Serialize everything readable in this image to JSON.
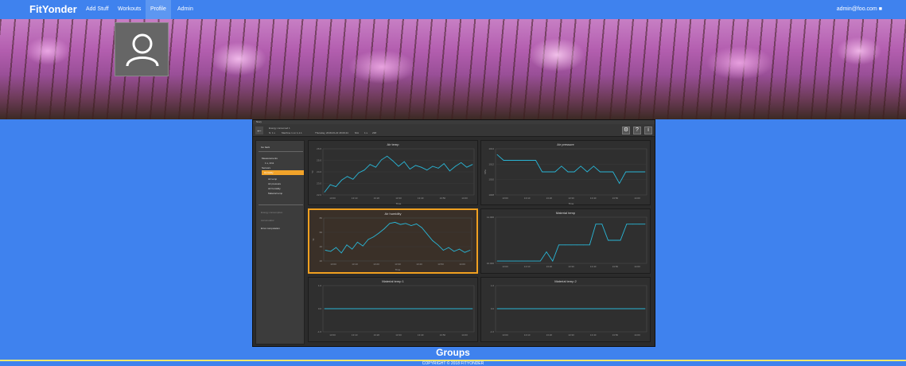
{
  "nav": {
    "brand": "FitYonder",
    "items": [
      "Add Stuff",
      "Workouts",
      "Profile",
      "Admin"
    ],
    "active": "Profile",
    "user": "admin@foo.com"
  },
  "colors": {
    "primary": "#3f82ee",
    "highlight": "#f0a020",
    "footer_line": "#f3e96b",
    "series": "#29b6d6"
  },
  "avatar_icon": "user-icon",
  "embedded_app": {
    "title": "Nuvy",
    "header": [
      "Energy consumed 1",
      "N: 1 s",
      "Machine 1 on 1-1.1",
      "Thursday, 2018-03-22 18:09:44",
      "N/A",
      "1 s",
      "238"
    ],
    "sidebar": {
      "back": "Go back",
      "items": [
        "Measurements",
        "1 s, 4/11",
        "Sensors",
        "Humidity",
        "Air temp",
        "Air pressure",
        "Air humidity",
        "Material temp",
        "Energy consumption",
        "Accumulator",
        "Error computation"
      ],
      "selected": "Humidity"
    },
    "charts": [
      {
        "title": "Air temp",
        "type": "line",
        "ylabel": "°C",
        "xlabel": "Time",
        "x_ticks": [
          "13:00",
          "13:10",
          "13:20",
          "13:30",
          "13:40",
          "13:50",
          "14:00"
        ],
        "y_ticks": [
          "26.0",
          "25.0",
          "24.0",
          "23.0",
          "22.0"
        ]
      },
      {
        "title": "Air pressure",
        "type": "line",
        "ylabel": "hPa",
        "xlabel": "Time",
        "x_ticks": [
          "13:00",
          "13:10",
          "13:20",
          "13:30",
          "13:40",
          "13:50",
          "14:00"
        ],
        "y_ticks": [
          "1014",
          "1012",
          "1010",
          "1008"
        ]
      },
      {
        "title": "Air humidity",
        "type": "line",
        "ylabel": "%",
        "xlabel": "Time",
        "highlighted": true,
        "x_ticks": [
          "13:00",
          "13:10",
          "13:20",
          "13:30",
          "13:40",
          "13:50",
          "14:00"
        ],
        "y_ticks": [
          "80",
          "60",
          "40",
          "20"
        ]
      },
      {
        "title": "Material temp",
        "type": "line",
        "ylabel": "",
        "xlabel": "",
        "x_ticks": [
          "13:00",
          "13:10",
          "13:20",
          "13:30",
          "13:40",
          "13:50",
          "14:00"
        ],
        "y_ticks": [
          "11.000",
          "10.000"
        ]
      },
      {
        "title": "Material temp 1",
        "type": "line",
        "ylabel": "",
        "xlabel": "",
        "x_ticks": [
          "13:00",
          "13:10",
          "13:20",
          "13:30",
          "13:40",
          "13:50",
          "14:00"
        ],
        "y_ticks": [
          "1.0",
          "0.0",
          "-1.0"
        ]
      },
      {
        "title": "Material temp 2",
        "type": "line",
        "ylabel": "",
        "xlabel": "",
        "x_ticks": [
          "13:00",
          "13:10",
          "13:20",
          "13:30",
          "13:40",
          "13:50",
          "14:00"
        ],
        "y_ticks": [
          "1.0",
          "0.0",
          "-1.0"
        ]
      }
    ]
  },
  "chart_data": [
    {
      "type": "line",
      "title": "Air temp",
      "xlabel": "Time",
      "ylabel": "°C",
      "ylim": [
        21.5,
        26.5
      ],
      "series": [
        {
          "values": [
            21.8,
            22.6,
            22.4,
            23.1,
            23.5,
            23.2,
            23.9,
            24.2,
            24.8,
            24.5,
            25.3,
            25.7,
            25.2,
            24.6,
            25.1,
            24.3,
            24.7,
            24.5,
            24.2,
            24.6,
            24.4,
            24.9,
            24.1,
            24.6,
            25.0,
            24.5,
            24.8
          ]
        }
      ]
    },
    {
      "type": "line",
      "title": "Air pressure",
      "xlabel": "Time",
      "ylabel": "hPa",
      "ylim": [
        1007,
        1015
      ],
      "series": [
        {
          "values": [
            1014,
            1013,
            1013,
            1013,
            1013,
            1013,
            1013,
            1011,
            1011,
            1011,
            1012,
            1011,
            1011,
            1012,
            1011,
            1012,
            1011,
            1011,
            1011,
            1009,
            1011,
            1011,
            1011,
            1011
          ]
        }
      ]
    },
    {
      "type": "line",
      "title": "Air humidity",
      "xlabel": "Time",
      "ylabel": "%",
      "ylim": [
        10,
        90
      ],
      "series": [
        {
          "values": [
            30,
            28,
            35,
            25,
            40,
            32,
            45,
            38,
            50,
            55,
            62,
            70,
            80,
            82,
            78,
            80,
            76,
            79,
            72,
            60,
            48,
            40,
            30,
            35,
            28,
            32,
            26,
            30
          ]
        }
      ]
    },
    {
      "type": "line",
      "title": "Material temp",
      "ylim": [
        9.5,
        11.5
      ],
      "series": [
        {
          "values": [
            9.6,
            9.6,
            9.6,
            9.6,
            9.6,
            9.6,
            9.6,
            9.6,
            10.0,
            9.6,
            10.3,
            10.3,
            10.3,
            10.3,
            10.3,
            10.3,
            11.2,
            11.2,
            10.5,
            10.5,
            10.5,
            11.2,
            11.2,
            11.2,
            11.2
          ]
        }
      ]
    },
    {
      "type": "line",
      "title": "Material temp 1",
      "ylim": [
        -1.2,
        1.2
      ],
      "series": [
        {
          "values": [
            0,
            0,
            0,
            0,
            0,
            0,
            0,
            0
          ]
        }
      ]
    },
    {
      "type": "line",
      "title": "Material temp 2",
      "ylim": [
        -1.2,
        1.2
      ],
      "series": [
        {
          "values": [
            0,
            0,
            0,
            0,
            0,
            0,
            0,
            0
          ]
        }
      ]
    }
  ],
  "groups_heading": "Groups",
  "footer": "COPYRIGHT © 2018 FITYONDER"
}
